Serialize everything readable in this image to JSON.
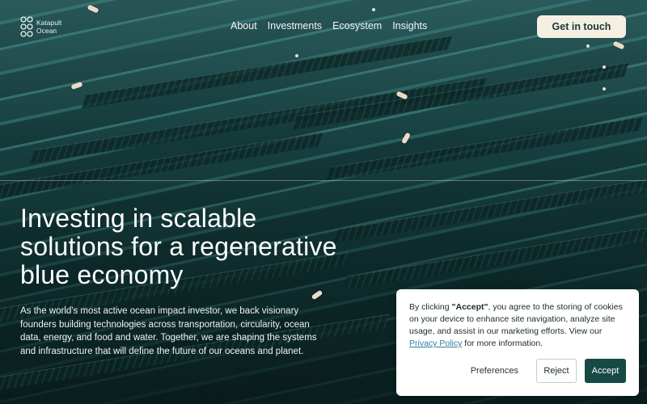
{
  "brand": {
    "logo_line1": "Katapult",
    "logo_line2": "Ocean"
  },
  "nav": {
    "items": [
      {
        "label": "About"
      },
      {
        "label": "Investments"
      },
      {
        "label": "Ecosystem"
      },
      {
        "label": "Insights"
      }
    ]
  },
  "header": {
    "cta_label": "Get in touch"
  },
  "hero": {
    "title": "Investing in scalable solutions for a regenerative blue economy",
    "body": "As the world's most active ocean impact investor, we back visionary founders building technologies across transportation, circularity, ocean data, energy, and food and water. Together, we are shaping the systems and infrastructure that will define the future of our oceans and planet."
  },
  "cookie_banner": {
    "text_before": "By clicking ",
    "accept_quote": "\"Accept\"",
    "text_middle": ", you agree to the storing of cookies on your device to enhance site navigation, analyze site usage, and assist in our marketing efforts. View our ",
    "privacy_link": "Privacy Policy",
    "text_after": " for more information.",
    "preferences_label": "Preferences",
    "reject_label": "Reject",
    "accept_label": "Accept"
  },
  "colors": {
    "cta_bg": "#f5efe2",
    "accept_bg": "#184a45",
    "link": "#2f7fa3"
  }
}
